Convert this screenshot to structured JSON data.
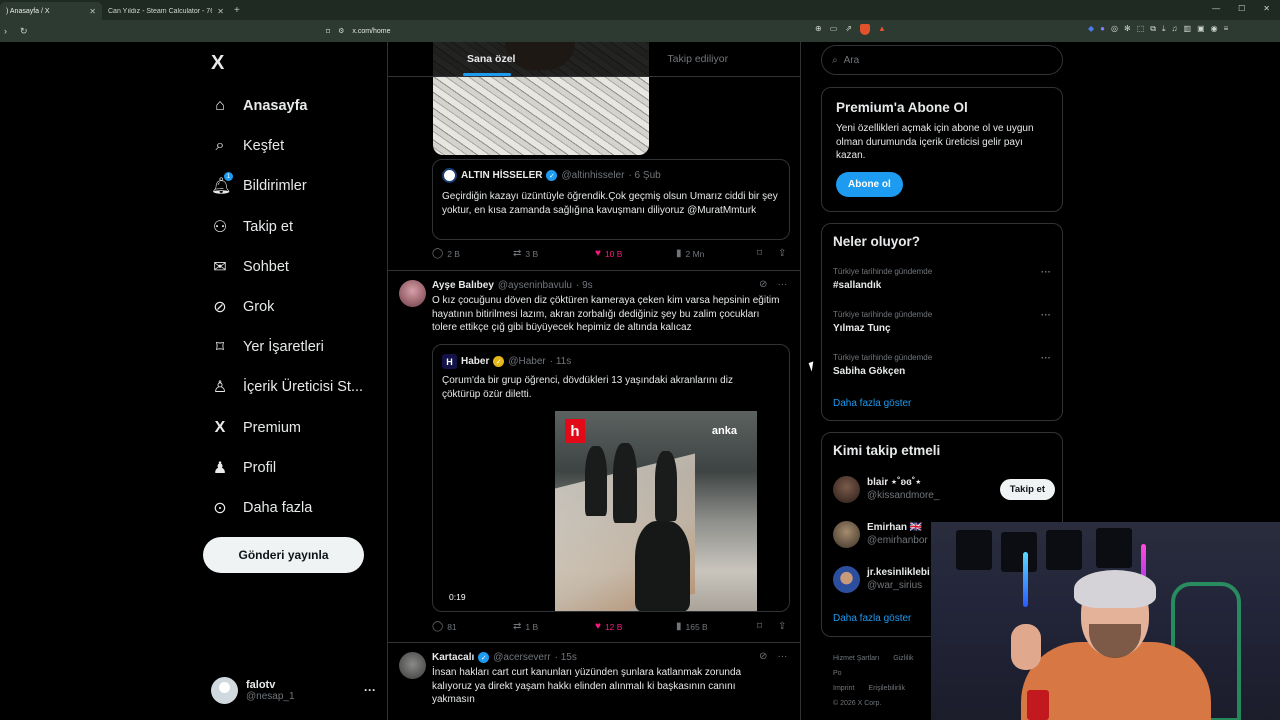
{
  "browser": {
    "tabs": [
      {
        "title": ") Anasayfa / X",
        "active": true
      },
      {
        "title": "Can Yıldız - Steam Calculator - 76561",
        "active": false
      }
    ],
    "url": "x.com/home"
  },
  "colors": {
    "accent": "#1d9bf0",
    "like": "#f91880",
    "border": "#2f3336",
    "muted": "#71767b"
  },
  "sidebar": {
    "logo": "X",
    "items": [
      {
        "label": "Anasayfa",
        "icon": "home-icon",
        "active": true
      },
      {
        "label": "Keşfet",
        "icon": "search-icon"
      },
      {
        "label": "Bildirimler",
        "icon": "bell-icon",
        "badge": "1"
      },
      {
        "label": "Takip et",
        "icon": "follow-icon"
      },
      {
        "label": "Sohbet",
        "icon": "mail-icon"
      },
      {
        "label": "Grok",
        "icon": "grok-icon"
      },
      {
        "label": "Yer İşaretleri",
        "icon": "bookmark-icon"
      },
      {
        "label": "İçerik Üreticisi St...",
        "icon": "creator-icon"
      },
      {
        "label": "Premium",
        "icon": "x-icon"
      },
      {
        "label": "Profil",
        "icon": "profile-icon"
      },
      {
        "label": "Daha fazla",
        "icon": "more-icon"
      }
    ],
    "post_button": "Gönderi yayınla",
    "account": {
      "name": "falotv",
      "handle": "@nesap_1",
      "more": "···"
    }
  },
  "feed": {
    "tabs": [
      "Sana özel",
      "Takip ediliyor"
    ],
    "tweets": [
      {
        "quote": {
          "name": "ALTIN HİSSELER",
          "handle": "@altinhisseler",
          "time": "· 6 Şub",
          "text": "Geçirdiğin kazayı üzüntüyle öğrendik.Çok geçmiş olsun Umarız ciddi bir şey yoktur, en kısa zamanda sağlığına kavuşmanı diliyoruz @MuratMmturk"
        },
        "actions": {
          "replies": "2 B",
          "retweets": "3 B",
          "likes": "10 B",
          "views": "2 Mn"
        }
      },
      {
        "name": "Ayşe Balıbey",
        "handle": "@ayseninbavulu",
        "time": "· 9s",
        "text": "O kız çocuğunu döven diz çöktüren kameraya çeken kim varsa hepsinin eğitim hayatının bitirilmesi lazım, akran zorbalığı dediğiniz şey bu  zalim çocukları tolere ettikçe çığ gibi büyüyecek hepimiz de altında kalıcaz",
        "quote": {
          "name": "Haber",
          "handle": "@Haber",
          "time": "· 11s",
          "text": "Çorum'da bir grup öğrenci, dövdükleri 13 yaşındaki akranlarını diz çöktürüp özür diletti.",
          "video": {
            "logo": "h",
            "watermark": "anka",
            "duration": "0:19"
          }
        },
        "actions": {
          "replies": "81",
          "retweets": "1 B",
          "likes": "12 B",
          "views": "165 B"
        }
      },
      {
        "name": "Kartacalı",
        "handle": "@acerseverr",
        "time": "· 15s",
        "text": "İnsan hakları cart curt kanunları yüzünden şunlara katlanmak zorunda kalıyoruz ya direkt yaşam hakkı elinden alınmalı ki başkasının canını yakmasın"
      }
    ]
  },
  "right": {
    "search_placeholder": "Ara",
    "premium": {
      "title": "Premium'a Abone Ol",
      "text": "Yeni özellikleri açmak için abone ol ve uygun olman durumunda içerik üreticisi gelir payı kazan.",
      "button": "Abone ol"
    },
    "trends": {
      "title": "Neler oluyor?",
      "items": [
        {
          "context": "Türkiye tarihinde gündemde",
          "topic": "#sallandık"
        },
        {
          "context": "Türkiye tarihinde gündemde",
          "topic": "Yılmaz Tunç"
        },
        {
          "context": "Türkiye tarihinde gündemde",
          "topic": "Sabiha Gökçen"
        }
      ],
      "more": "Daha fazla göster"
    },
    "who_to_follow": {
      "title": "Kimi takip etmeli",
      "items": [
        {
          "name": "blair ⋆˚ʚɞ˚⋆",
          "handle": "@kissandmore_",
          "button": "Takip et"
        },
        {
          "name": "Emirhan 🇬🇧",
          "handle": "@emirhanbor"
        },
        {
          "name": "jr.kesinliklebi",
          "handle": "@war_sirius"
        }
      ],
      "more": "Daha fazla göster"
    },
    "footer": [
      "Hizmet Şartları",
      "Gizlilik Po",
      "Imprint",
      "Erişilebilirlik",
      "© 2026 X Corp."
    ]
  }
}
